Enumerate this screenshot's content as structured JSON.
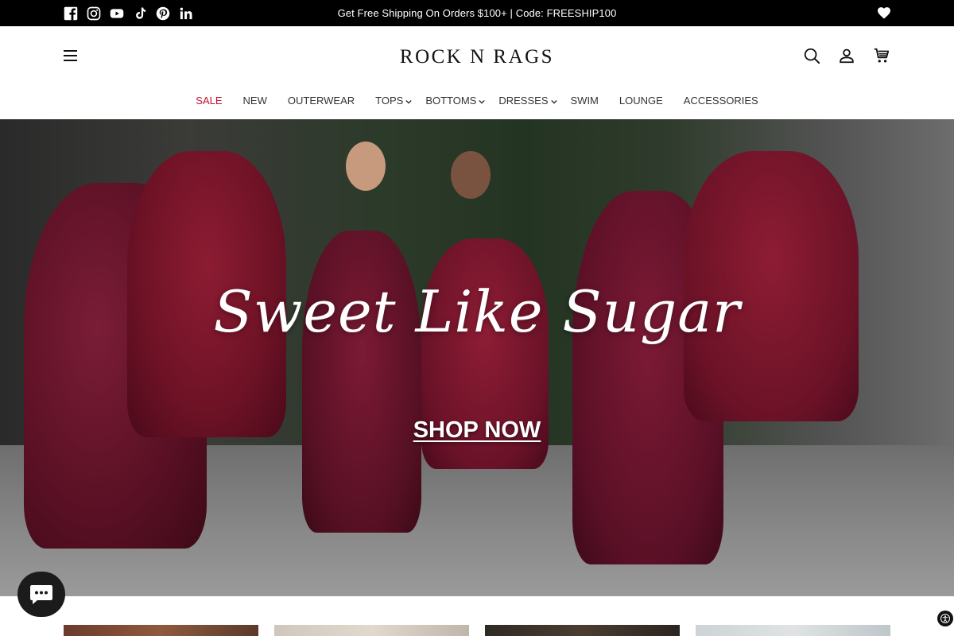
{
  "topbar": {
    "announcement": "Get Free Shipping On Orders $100+ | Code: FREESHIP100",
    "social_icons": [
      "facebook-icon",
      "instagram-icon",
      "youtube-icon",
      "tiktok-icon",
      "pinterest-icon",
      "linkedin-icon"
    ]
  },
  "header": {
    "logo": "ROCK N RAGS",
    "icons": [
      "search-icon",
      "account-icon",
      "cart-icon"
    ]
  },
  "nav": {
    "items": [
      {
        "label": "SALE",
        "dropdown": false
      },
      {
        "label": "NEW",
        "dropdown": false
      },
      {
        "label": "OUTERWEAR",
        "dropdown": false
      },
      {
        "label": "TOPS",
        "dropdown": true
      },
      {
        "label": "BOTTOMS",
        "dropdown": true
      },
      {
        "label": "DRESSES",
        "dropdown": true
      },
      {
        "label": "SWIM",
        "dropdown": false
      },
      {
        "label": "LOUNGE",
        "dropdown": false
      },
      {
        "label": "ACCESSORIES",
        "dropdown": false
      }
    ]
  },
  "hero": {
    "title": "Sweet Like Sugar",
    "cta": "SHOP NOW"
  },
  "colors": {
    "topbar_bg": "#000000",
    "sale": "#c8102e",
    "dress": "#6e1226"
  }
}
